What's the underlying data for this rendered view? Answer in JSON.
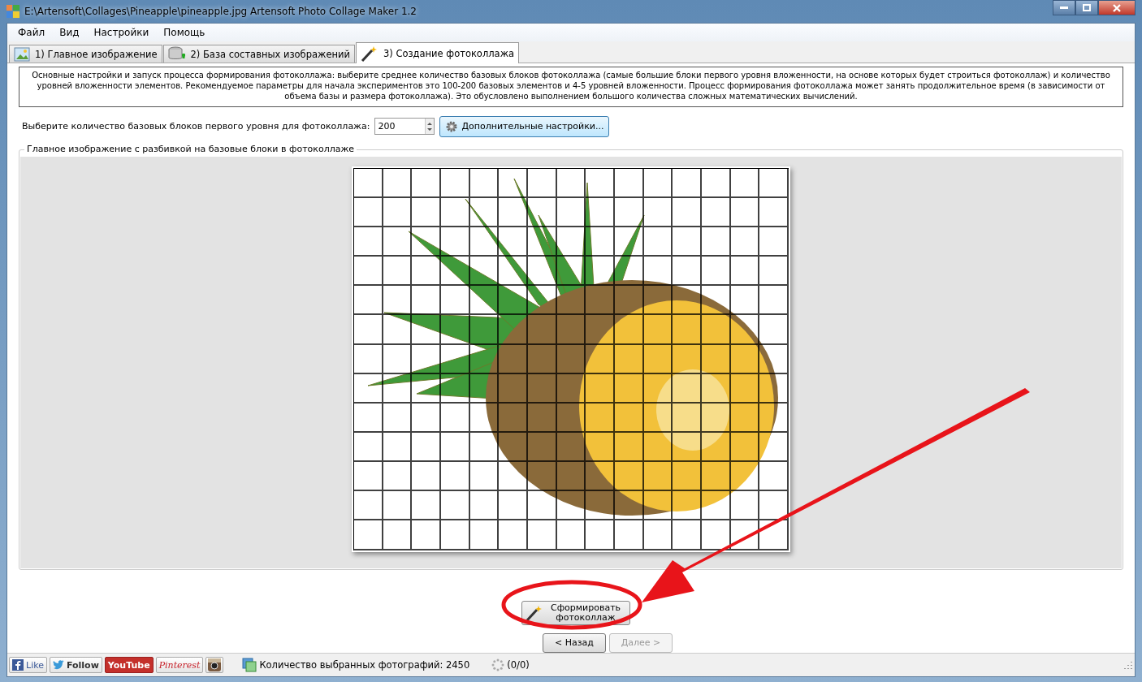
{
  "window": {
    "title": "E:\\Artensoft\\Collages\\Pineapple\\pineapple.jpg Artensoft Photo Collage Maker 1.2"
  },
  "menu": [
    "Файл",
    "Вид",
    "Настройки",
    "Помощь"
  ],
  "tabs": [
    {
      "label": "1) Главное изображение",
      "selected": false,
      "kind": "picture"
    },
    {
      "label": "2) База составных изображений",
      "selected": false,
      "kind": "database"
    },
    {
      "label": "3) Создание фотоколлажа",
      "selected": true,
      "kind": "wand"
    }
  ],
  "description": "Основные настройки и запуск процесса формирования фотоколлажа: выберите среднее количество базовых блоков фотоколлажа (самые большие блоки первого уровня вложенности, на основе которых будет строиться фотоколлаж) и количество уровней вложенности элементов. Рекомендуемое параметры для начала экспериментов это 100-200 базовых элементов и 4-5 уровней вложенности.  Процесс формирования фотоколлажа может занять продолжительное время (в зависимости от объема базы и размера фотоколлажа). Это обусловлено выполнением большого количества сложных математических вычислений.",
  "settings": {
    "label": "Выберите количество базовых блоков первого уровня для фотоколлажа:",
    "value": "200",
    "button": "Дополнительные настройки..."
  },
  "preview": {
    "title": "Главное изображение с разбивкой на базовые блоки в фотоколлаже"
  },
  "create_button": "Сформировать фотоколлаж",
  "nav_buttons": [
    {
      "label": "< Назад",
      "disabled": false
    },
    {
      "label": "Далее >",
      "disabled": true
    }
  ],
  "status_bar": {
    "social": [
      {
        "kind": "facebook",
        "label": "Like"
      },
      {
        "kind": "twitter",
        "label": "Follow"
      },
      {
        "kind": "youtube",
        "label": "YouTube"
      },
      {
        "kind": "pinterest",
        "label": "Pinterest"
      },
      {
        "kind": "instagram"
      }
    ],
    "count": "Количество выбранных фотографий: 2450",
    "progress": "(0/0)"
  }
}
